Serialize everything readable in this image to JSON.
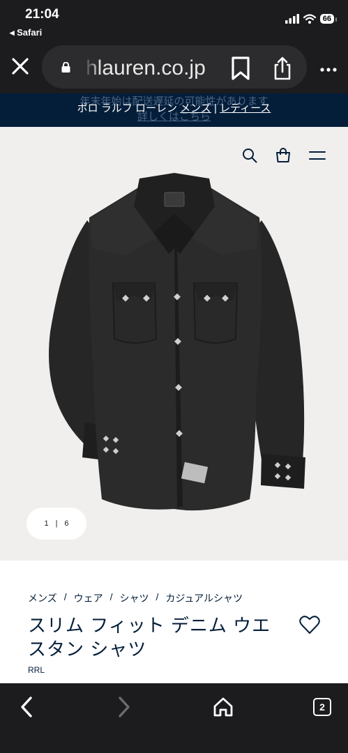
{
  "status_bar": {
    "time": "21:04",
    "back_app": "◂ Safari",
    "battery": "66"
  },
  "url_bar": {
    "url": "hlauren.co.jp"
  },
  "banner": {
    "ghost_line_1": "年末年始は配送遅延の可能性があります",
    "ghost_line_2": "詳しくはこちら",
    "brand_prefix": "ポロ ラルフ ローレン",
    "mens_link": "メンズ",
    "divider": "|",
    "ladies_link": "レディース"
  },
  "hero": {
    "pager_current": "1",
    "pager_divider": "|",
    "pager_total": "6"
  },
  "product": {
    "breadcrumb": [
      "メンズ",
      "ウェア",
      "シャツ",
      "カジュアルシャツ"
    ],
    "breadcrumb_sep": "/",
    "title": "スリム フィット デニム ウエスタン シャツ",
    "brand": "RRL"
  },
  "toolbar": {
    "tab_count": "2"
  },
  "colors": {
    "navy": "#041e3a",
    "chrome": "#1c1c1e",
    "hero_bg": "#f0efed"
  }
}
